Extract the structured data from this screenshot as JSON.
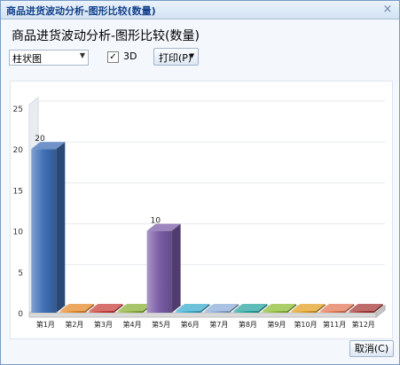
{
  "window": {
    "title": "商品进货波动分析-图形比较(数量)",
    "close_symbol": "×"
  },
  "heading": "商品进货波动分析-图形比较(数量)",
  "toolbar": {
    "chart_type_value": "柱状图",
    "checkbox_3d_label": "3D",
    "checkbox_3d_checked": true,
    "check_mark": "✓",
    "print_label": "打印(P)",
    "dropdown_arrow": "▼"
  },
  "footer": {
    "cancel_label": "取消(C)"
  },
  "chart_data": {
    "type": "bar",
    "three_d": true,
    "categories": [
      "第1月",
      "第2月",
      "第3月",
      "第4月",
      "第5月",
      "第6月",
      "第7月",
      "第8月",
      "第9月",
      "第10月",
      "第11月",
      "第12月"
    ],
    "values": [
      20,
      0,
      0,
      0,
      10,
      0,
      0,
      0,
      0,
      0,
      0,
      0
    ],
    "data_labels": [
      "20",
      "",
      "",
      "",
      "10",
      "",
      "",
      "",
      "",
      "",
      "",
      ""
    ],
    "colors": [
      "#3f6fb5",
      "#e58a2c",
      "#c9413d",
      "#8cb23a",
      "#7b5ea7",
      "#3eaed0",
      "#8faed8",
      "#2aa6a0",
      "#8fbd3a",
      "#e2a126",
      "#e37a58",
      "#a83a3a"
    ],
    "y_ticks": [
      0,
      5,
      10,
      15,
      20,
      25
    ],
    "ylim": [
      0,
      25
    ],
    "grid": true
  }
}
